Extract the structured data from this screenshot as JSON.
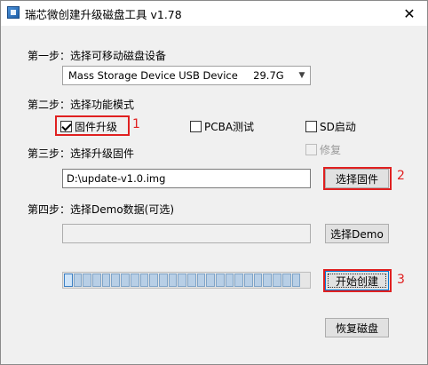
{
  "window": {
    "title": "瑞芯微创建升级磁盘工具 v1.78",
    "close_glyph": "✕"
  },
  "step1": {
    "label": "第一步：选择可移动磁盘设备",
    "device_name": "Mass Storage Device USB Device",
    "device_size": "29.7G"
  },
  "step2": {
    "label": "第二步：选择功能模式",
    "options": [
      {
        "label": "固件升级",
        "checked": true,
        "enabled": true
      },
      {
        "label": "PCBA测试",
        "checked": false,
        "enabled": true
      },
      {
        "label": "SD启动",
        "checked": false,
        "enabled": true
      },
      {
        "label": "修复",
        "checked": false,
        "enabled": false
      }
    ]
  },
  "step3": {
    "label": "第三步：选择升级固件",
    "path": "D:\\update-v1.0.img",
    "button": "选择固件"
  },
  "step4": {
    "label": "第四步：选择Demo数据(可选)",
    "path": "",
    "button": "选择Demo"
  },
  "progress": {
    "segments": 25,
    "value": 0.0
  },
  "actions": {
    "create": "开始创建",
    "restore": "恢复磁盘"
  },
  "annotations": {
    "a1": "1",
    "a2": "2",
    "a3": "3",
    "color": "#e02020"
  }
}
